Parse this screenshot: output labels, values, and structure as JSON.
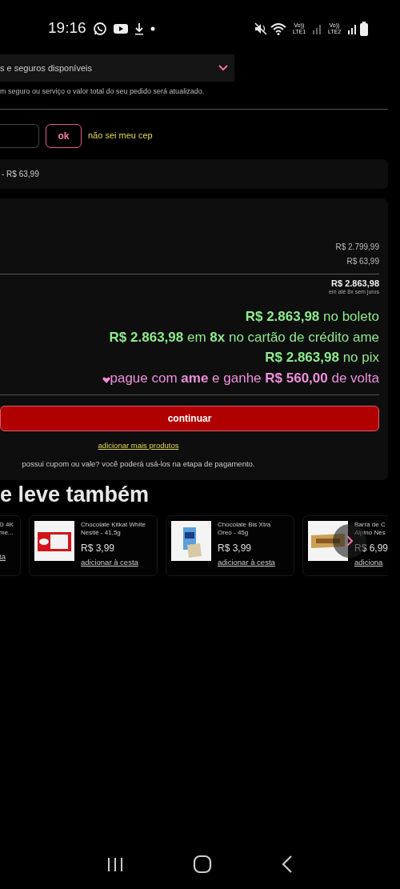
{
  "status_bar": {
    "time": "19:16",
    "network_1": "Vo)) LTE1",
    "network_2": "Vo)) LTE2"
  },
  "services": {
    "select": {
      "value": "s e seguros disponíveis"
    },
    "note": "m seguro ou serviço o valor total do seu pedido será atualizado."
  },
  "cep": {
    "button": "ok",
    "link": "não sei meu cep"
  },
  "shipping": {
    "option": "- R$ 63,99"
  },
  "summary": {
    "subtotal": "R$ 2.799,99",
    "freight": "R$ 63,99",
    "total": "R$ 2.863,98",
    "installments": "em até 8x sem juros",
    "offers": [
      {
        "kind": "price",
        "text": "**R$ 2.863,98** no boleto"
      },
      {
        "kind": "price",
        "text": "**R$ 2.863,98** em **8x** no cartão de crédito ame"
      },
      {
        "kind": "price",
        "text": "**R$ 2.863,98** no pix"
      },
      {
        "kind": "cashback",
        "text": "pague com **ame** e ganhe **R$ 560,00** de volta"
      }
    ],
    "continue_button": "continuar",
    "more_link": "adicionar mais produtos",
    "coupon_note": "possui cupom ou vale? você poderá usá-los na etapa de pagamento."
  },
  "recommendations": {
    "title": "e leve também",
    "products": [
      {
        "kind": "text",
        "name": "D 4K\nme...",
        "link": "ta"
      },
      {
        "kind": "picture",
        "name": "Chocolate Kitkat White\nNestlé - 41,5g",
        "price": "R$ 3,99",
        "link": "adicionar à cesta"
      },
      {
        "kind": "picture",
        "name": "Chocolate Bis Xtra\nOreo - 45g",
        "price": "R$ 3,99",
        "link": "adicionar à cesta"
      },
      {
        "kind": "picture",
        "name": "Barra de C\nAlpino Nes",
        "price": "R$ 6,99",
        "link": "adiciona"
      }
    ]
  }
}
